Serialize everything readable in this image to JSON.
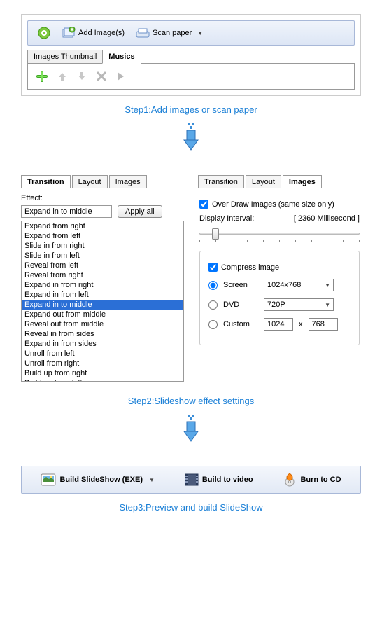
{
  "step1": {
    "add_images": "Add Image(s)",
    "scan_paper": "Scan paper",
    "tab_thumbnail": "Images Thumbnail",
    "tab_musics": "Musics",
    "caption": "Step1:Add images or scan paper"
  },
  "step2": {
    "left": {
      "tab_transition": "Transition",
      "tab_layout": "Layout",
      "tab_images": "Images",
      "effect_label": "Effect:",
      "effect_value": "Expand in to middle",
      "apply_all": "Apply all",
      "options": [
        "Expand from right",
        "Expand from left",
        "Slide in from right",
        "Slide in from left",
        "Reveal from left",
        "Reveal from right",
        "Expand in from right",
        "Expand in from left",
        "Expand in to middle",
        "Expand out from middle",
        "Reveal out from middle",
        "Reveal in from sides",
        "Expand in from sides",
        "Unroll from left",
        "Unroll from right",
        "Build up from right",
        "Build up from left"
      ],
      "selected_index": 8
    },
    "right": {
      "tab_transition": "Transition",
      "tab_layout": "Layout",
      "tab_images": "Images",
      "over_draw": "Over Draw Images (same size only)",
      "display_interval_label": "Display Interval:",
      "display_interval_value": "[ 2360 Millisecond ]",
      "compress": "Compress image",
      "screen_label": "Screen",
      "screen_value": "1024x768",
      "dvd_label": "DVD",
      "dvd_value": "720P",
      "custom_label": "Custom",
      "custom_w": "1024",
      "custom_x": "x",
      "custom_h": "768"
    },
    "caption": "Step2:Slideshow effect settings"
  },
  "step3": {
    "build_exe": "Build SlideShow (EXE)",
    "build_video": "Build to video",
    "burn_cd": "Burn to CD",
    "caption": "Step3:Preview and build SlideShow"
  }
}
